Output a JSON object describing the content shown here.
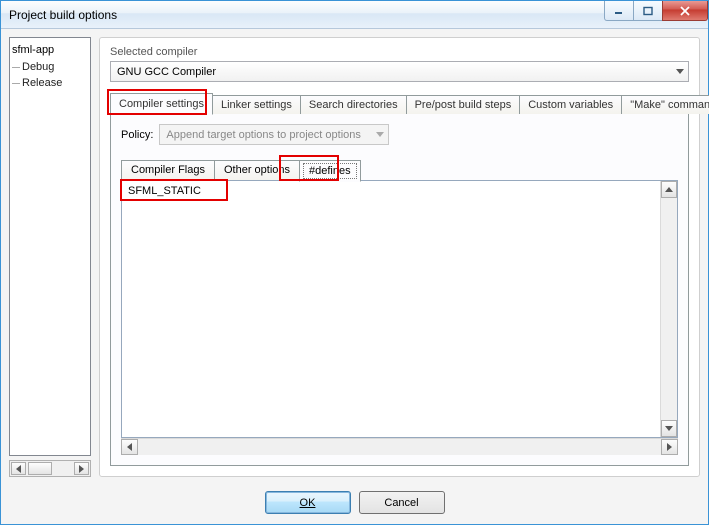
{
  "window": {
    "title": "Project build options"
  },
  "tree": {
    "root": "sfml-app",
    "children": [
      "Debug",
      "Release"
    ]
  },
  "selected_compiler": {
    "label": "Selected compiler",
    "value": "GNU GCC Compiler"
  },
  "main_tabs": {
    "items": [
      "Compiler settings",
      "Linker settings",
      "Search directories",
      "Pre/post build steps",
      "Custom variables",
      "\"Make\" commands"
    ],
    "active_index": 0
  },
  "policy": {
    "label": "Policy:",
    "value": "Append target options to project options"
  },
  "sub_tabs": {
    "items": [
      "Compiler Flags",
      "Other options",
      "#defines"
    ],
    "active_index": 2
  },
  "defines_text": "SFML_STATIC",
  "buttons": {
    "ok": "OK",
    "cancel": "Cancel"
  },
  "highlights": [
    "compiler-settings-tab",
    "defines-subtab",
    "defines-first-line"
  ]
}
